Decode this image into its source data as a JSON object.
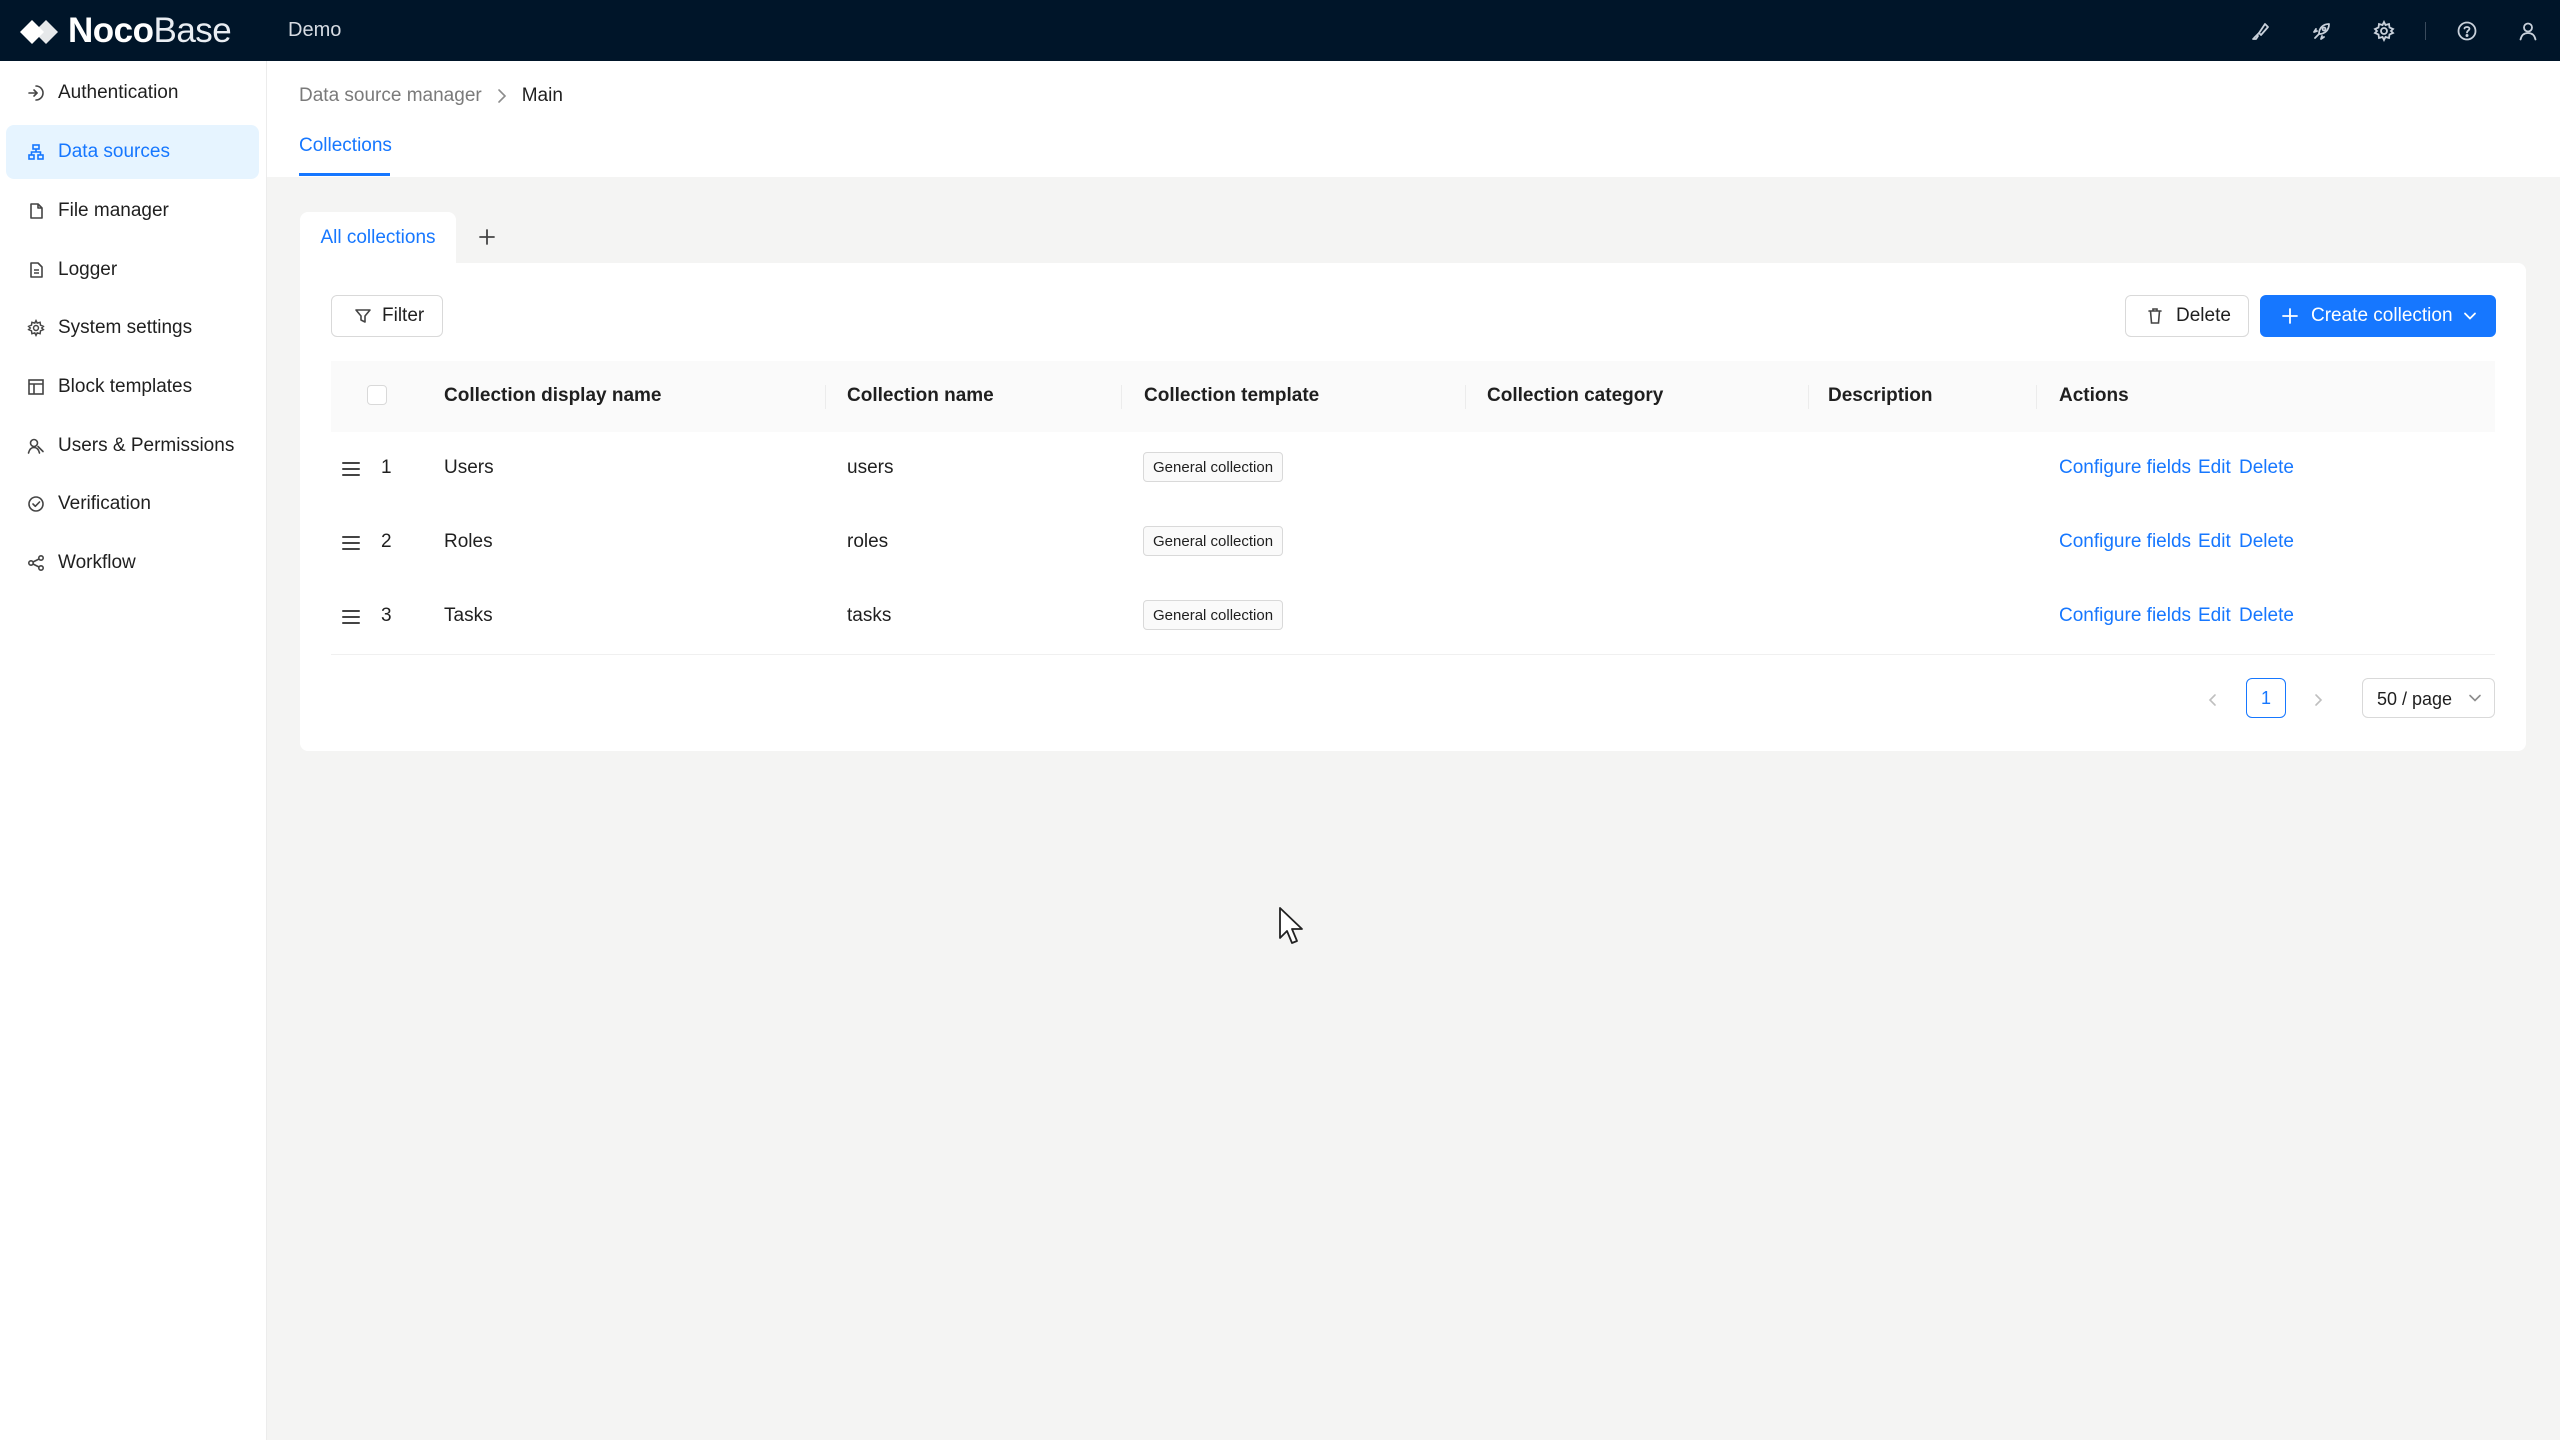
{
  "topbar": {
    "logo_bold": "Noco",
    "logo_light": "Base",
    "app_title": "Demo",
    "icons": [
      "paint-brush-icon",
      "rocket-icon",
      "gear-icon",
      "help-circle-icon",
      "user-icon"
    ]
  },
  "sidebar": {
    "items": [
      {
        "label": "Authentication",
        "icon": "login-icon"
      },
      {
        "label": "Data sources",
        "icon": "data-source-icon",
        "active": true
      },
      {
        "label": "File manager",
        "icon": "file-icon"
      },
      {
        "label": "Logger",
        "icon": "file-text-icon"
      },
      {
        "label": "System settings",
        "icon": "gear-icon"
      },
      {
        "label": "Block templates",
        "icon": "layout-icon"
      },
      {
        "label": "Users & Permissions",
        "icon": "users-icon"
      },
      {
        "label": "Verification",
        "icon": "check-circle-icon"
      },
      {
        "label": "Workflow",
        "icon": "workflow-icon"
      }
    ]
  },
  "header": {
    "breadcrumb": [
      "Data source manager",
      "Main"
    ],
    "tab": "Collections"
  },
  "content": {
    "category_tab": "All collections",
    "filter_label": "Filter",
    "delete_label": "Delete",
    "create_label": "Create collection",
    "columns": [
      "Collection display name",
      "Collection name",
      "Collection template",
      "Collection category",
      "Description",
      "Actions"
    ],
    "rows": [
      {
        "index": "1",
        "display_name": "Users",
        "name": "users",
        "template": "General collection",
        "category": "",
        "description": ""
      },
      {
        "index": "2",
        "display_name": "Roles",
        "name": "roles",
        "template": "General collection",
        "category": "",
        "description": ""
      },
      {
        "index": "3",
        "display_name": "Tasks",
        "name": "tasks",
        "template": "General collection",
        "category": "",
        "description": ""
      }
    ],
    "row_actions": {
      "configure": "Configure fields",
      "edit": "Edit",
      "delete": "Delete"
    },
    "pagination": {
      "current_page": "1",
      "page_size": "50 / page"
    }
  },
  "colors": {
    "topbar": "#001529",
    "primary": "#1677ff",
    "active_bg": "#e6f4ff",
    "page_bg": "#f4f4f3"
  }
}
